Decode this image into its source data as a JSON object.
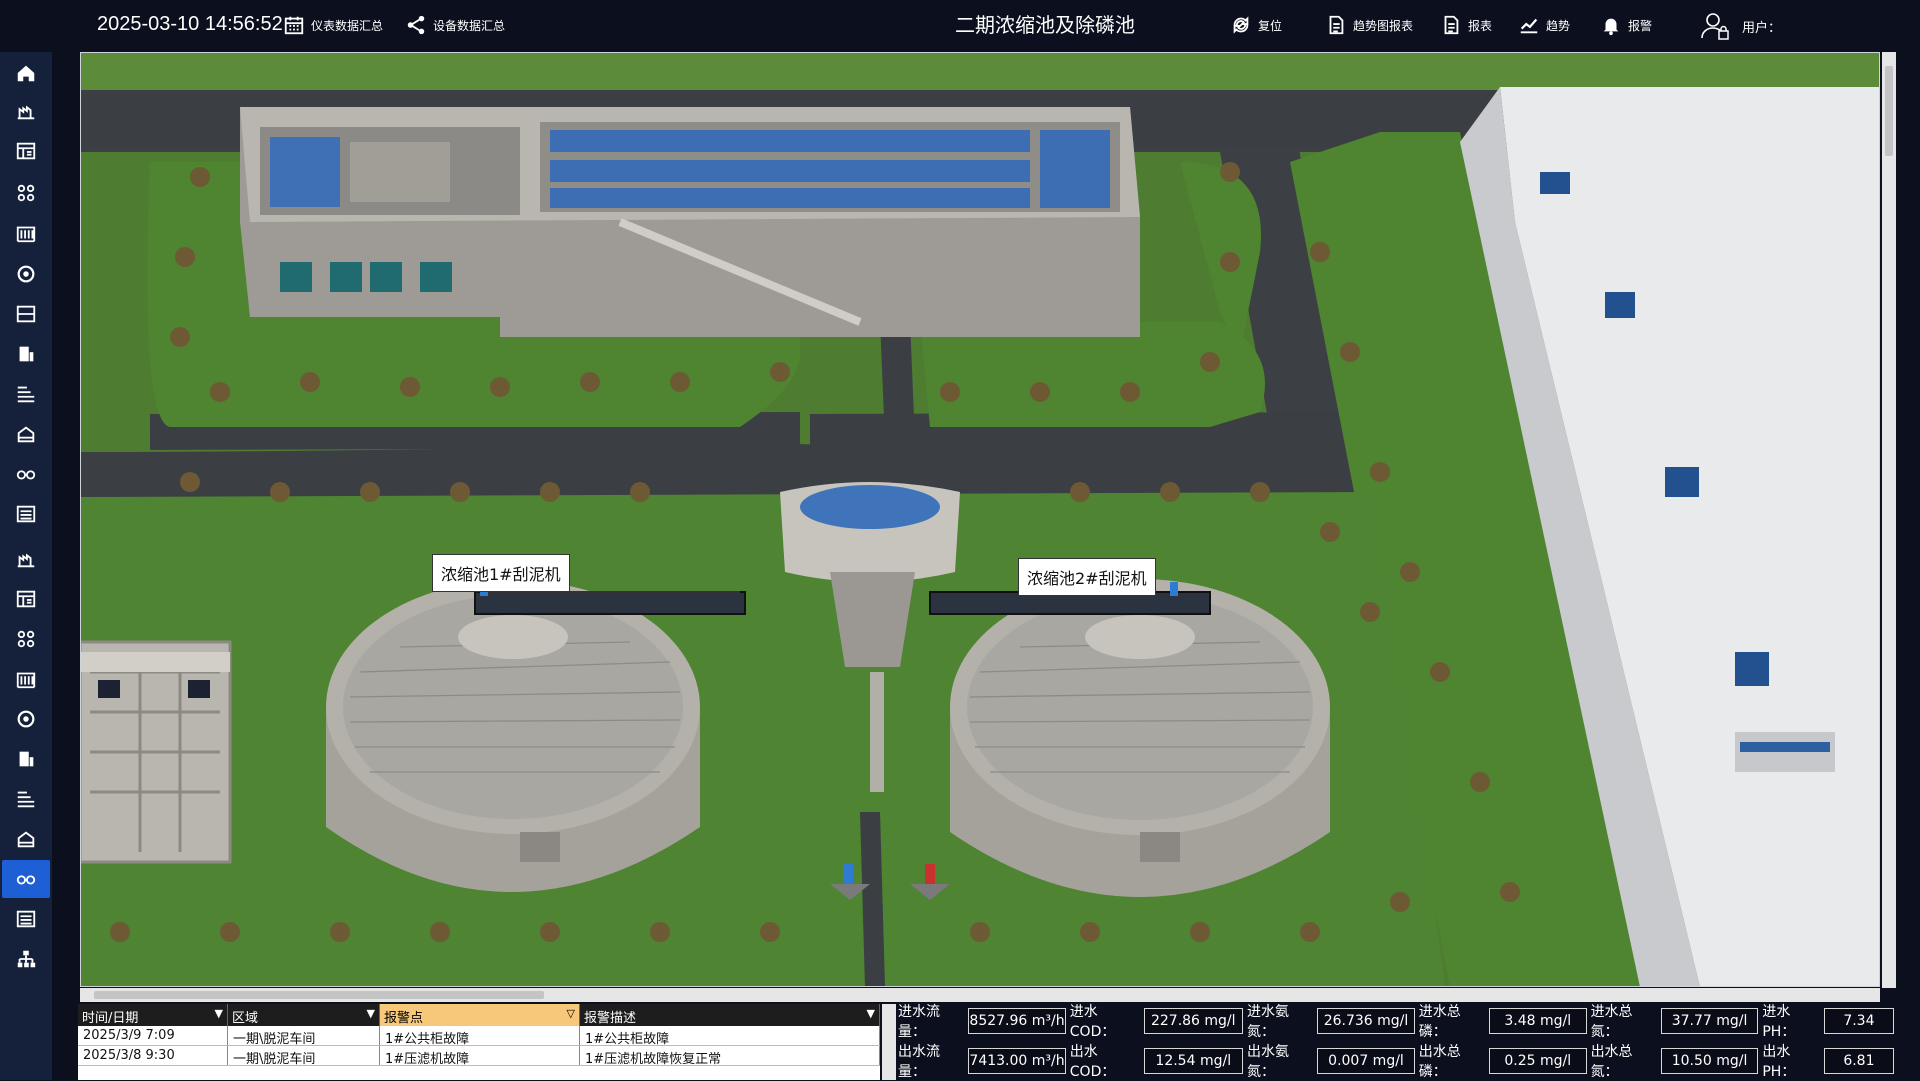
{
  "header": {
    "datetime": "2025-03-10 14:56:52",
    "meter_summary_label": "仪表数据汇总",
    "equipment_summary_label": "设备数据汇总",
    "page_title": "二期浓缩池及除磷池",
    "reset_label": "复位",
    "trend_report_label": "趋势图报表",
    "report_label": "报表",
    "trend_label": "趋势",
    "alarm_label": "报警",
    "user_label": "用户："
  },
  "sidebar": {
    "items": [
      {
        "icon": "home-icon"
      },
      {
        "icon": "plant-icon"
      },
      {
        "icon": "panel-icon"
      },
      {
        "icon": "nodes-icon"
      },
      {
        "icon": "building-icon"
      },
      {
        "icon": "blower-icon"
      },
      {
        "icon": "screen-icon"
      },
      {
        "icon": "tank-icon"
      },
      {
        "icon": "process-icon"
      },
      {
        "icon": "house-icon"
      },
      {
        "icon": "glasses-icon"
      },
      {
        "icon": "list-icon"
      },
      {
        "icon": "plant-icon"
      },
      {
        "icon": "panel-icon"
      },
      {
        "icon": "nodes-icon"
      },
      {
        "icon": "building-icon"
      },
      {
        "icon": "blower-icon"
      },
      {
        "icon": "tank-icon"
      },
      {
        "icon": "process-icon"
      },
      {
        "icon": "house-icon"
      },
      {
        "icon": "glasses-icon"
      },
      {
        "icon": "list-icon"
      },
      {
        "icon": "org-icon"
      }
    ],
    "active_index": 20
  },
  "scene": {
    "labels": {
      "scraper1": "浓缩池1#刮泥机",
      "scraper2": "浓缩池2#刮泥机"
    }
  },
  "alarm_table": {
    "columns": [
      "时间/日期",
      "区域",
      "报警点",
      "报警描述"
    ],
    "sorted_column": 2,
    "rows": [
      [
        "2025/3/9 7:09",
        "一期\\脱泥车间",
        "1#公共柜故障",
        "1#公共柜故障"
      ],
      [
        "2025/3/8 9:30",
        "一期\\脱泥车间",
        "1#压滤机故障",
        "1#压滤机故障恢复正常"
      ]
    ]
  },
  "water_quality": {
    "inflow": [
      {
        "label": "进水流量：",
        "value": "8527.96 m³/h"
      },
      {
        "label": "进水COD：",
        "value": "227.86  mg/l"
      },
      {
        "label": "进水氨氮：",
        "value": "26.736  mg/l"
      },
      {
        "label": "进水总磷：",
        "value": "3.48  mg/l"
      },
      {
        "label": "进水总氮：",
        "value": "37.77  mg/l"
      },
      {
        "label": "进水PH：",
        "value": "7.34"
      }
    ],
    "outflow": [
      {
        "label": "出水流量：",
        "value": "7413.00 m³/h"
      },
      {
        "label": "出水COD：",
        "value": "12.54 mg/l"
      },
      {
        "label": "出水氨氮：",
        "value": "0.007  mg/l"
      },
      {
        "label": "出水总磷：",
        "value": "0.25  mg/l"
      },
      {
        "label": "出水总氮：",
        "value": "10.50  mg/l"
      },
      {
        "label": "出水PH：",
        "value": "6.81"
      }
    ]
  }
}
